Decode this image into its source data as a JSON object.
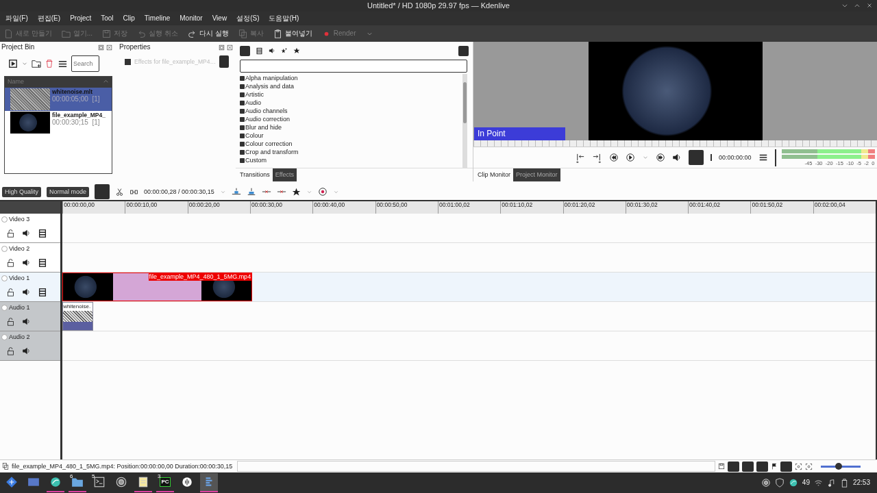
{
  "window": {
    "title": "Untitled* / HD 1080p 29.97 fps — Kdenlive"
  },
  "menu": [
    "파일(F)",
    "편집(E)",
    "Project",
    "Tool",
    "Clip",
    "Timeline",
    "Monitor",
    "View",
    "설정(S)",
    "도움말(H)"
  ],
  "toolbar": [
    {
      "kind": "new",
      "label": "새로 만들기",
      "disabled": true
    },
    {
      "kind": "open",
      "label": "열기...",
      "disabled": true
    },
    {
      "kind": "save",
      "label": "저장",
      "disabled": true
    },
    {
      "kind": "undo",
      "label": "실행 취소",
      "disabled": true
    },
    {
      "kind": "redo",
      "label": "다시 실행",
      "disabled": false
    },
    {
      "kind": "copy",
      "label": "복사",
      "disabled": true
    },
    {
      "kind": "paste",
      "label": "붙여넣기",
      "disabled": false
    },
    {
      "kind": "render",
      "label": "Render",
      "disabled": true
    }
  ],
  "project_bin": {
    "title": "Project Bin",
    "search": {
      "placeholder": "Search"
    },
    "column": "Name",
    "clips": [
      {
        "kind": "noise",
        "name": "whitenoise.mlt",
        "duration": "00:00:05;00",
        "count": "[1]",
        "selected": true
      },
      {
        "kind": "video",
        "name": "file_example_MP4_",
        "duration": "00:00:30;15",
        "count": "[1]",
        "selected": false
      }
    ]
  },
  "properties": {
    "title": "Properties",
    "effects_label": "Effects for file_example_MP4…"
  },
  "effects": {
    "categories": [
      "Alpha manipulation",
      "Analysis and data",
      "Artistic",
      "Audio",
      "Audio channels",
      "Audio correction",
      "Blur and hide",
      "Colour",
      "Colour correction",
      "Crop and transform",
      "Custom"
    ],
    "tabs": [
      {
        "label": "Transitions",
        "selected": true
      },
      {
        "label": "Effects",
        "selected": false
      }
    ]
  },
  "monitor": {
    "overlay": "In Point",
    "timecode": "00:00:00:00",
    "meter_ticks": [
      "-45",
      "-30",
      "-20",
      "-15",
      "-10",
      "-5",
      "-2",
      "0"
    ],
    "tabs": [
      {
        "label": "Clip Monitor",
        "selected": true
      },
      {
        "label": "Project Monitor",
        "selected": false
      }
    ]
  },
  "timeline": {
    "quality": "High Quality",
    "mode": "Normal mode",
    "position": "00:00:00,28 / 00:00:30,15",
    "ruler": [
      "00:00:00,00",
      "00:00:10,00",
      "00:00:20,00",
      "00:00:30,00",
      "00:00:40,00",
      "00:00:50,00",
      "00:01:00,02",
      "00:01:10,02",
      "00:01:20,02",
      "00:01:30,02",
      "00:01:40,02",
      "00:01:50,02",
      "00:02:00,04"
    ],
    "tracks": [
      {
        "name": "Video 3",
        "kind": "video",
        "selected": false
      },
      {
        "name": "Video 2",
        "kind": "video",
        "selected": false
      },
      {
        "name": "Video 1",
        "kind": "video",
        "selected": true,
        "clips": [
          {
            "kind": "video",
            "label": "file_example_MP4_480_1_5MG.mp4"
          }
        ]
      },
      {
        "name": "Audio 1",
        "kind": "audio",
        "selected": false,
        "clips": [
          {
            "kind": "noise",
            "label": "whitenoise."
          }
        ]
      },
      {
        "name": "Audio 2",
        "kind": "audio",
        "selected": false
      }
    ]
  },
  "status_bar": {
    "message": "file_example_MP4_480_1_5MG.mp4: Position:00:00:00,00 Duration:00:00:30,15",
    "zoom": {
      "level": 0.45
    }
  },
  "taskbar": {
    "apps": [
      {
        "kind": "launcher",
        "running": false,
        "selected": false
      },
      {
        "kind": "desktop",
        "running": false,
        "selected": false
      },
      {
        "kind": "bird",
        "running": true,
        "selected": false
      },
      {
        "kind": "folder",
        "badge": "6",
        "running": true,
        "selected": false
      },
      {
        "kind": "terminal",
        "badge": "5",
        "running": false,
        "selected": false
      },
      {
        "kind": "camera",
        "running": false,
        "selected": false
      },
      {
        "kind": "notes",
        "running": true,
        "selected": false
      },
      {
        "kind": "ide",
        "badge": "3",
        "logo": "PC",
        "running": true,
        "selected": false
      },
      {
        "kind": "audio",
        "running": false,
        "selected": false
      },
      {
        "kind": "editor",
        "running": true,
        "selected": true
      }
    ],
    "tray_text": "49",
    "clock": "22:53"
  }
}
